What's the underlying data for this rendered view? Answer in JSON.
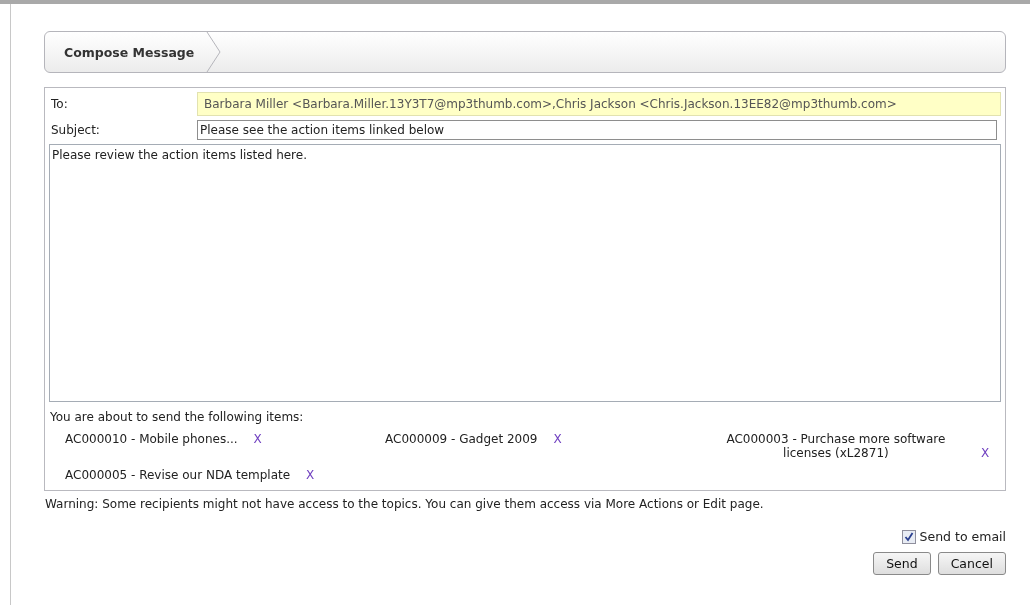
{
  "header": {
    "title": "Compose Message"
  },
  "form": {
    "to_label": "To:",
    "to_value": "Barbara Miller <Barbara.Miller.13Y3T7@mp3thumb.com>,Chris Jackson <Chris.Jackson.13EE82@mp3thumb.com>",
    "subject_label": "Subject:",
    "subject_value": "Please see the action items linked below",
    "body": "Please review the action items listed here."
  },
  "items_heading": "You are about to send the following items:",
  "items": [
    {
      "label": "AC000010 - Mobile phones...",
      "remove": "X"
    },
    {
      "label": "AC000009 - Gadget 2009",
      "remove": "X"
    },
    {
      "label": "AC000003 - Purchase more software licenses (xL2871)",
      "remove": "X"
    },
    {
      "label": "AC000005 - Revise our NDA template",
      "remove": "X"
    }
  ],
  "warning": "Warning: Some recipients might not have access to the topics. You can give them access via More Actions or Edit page.",
  "send_to_email": {
    "label": "Send to email",
    "checked": true
  },
  "buttons": [
    "Send",
    "Cancel"
  ]
}
